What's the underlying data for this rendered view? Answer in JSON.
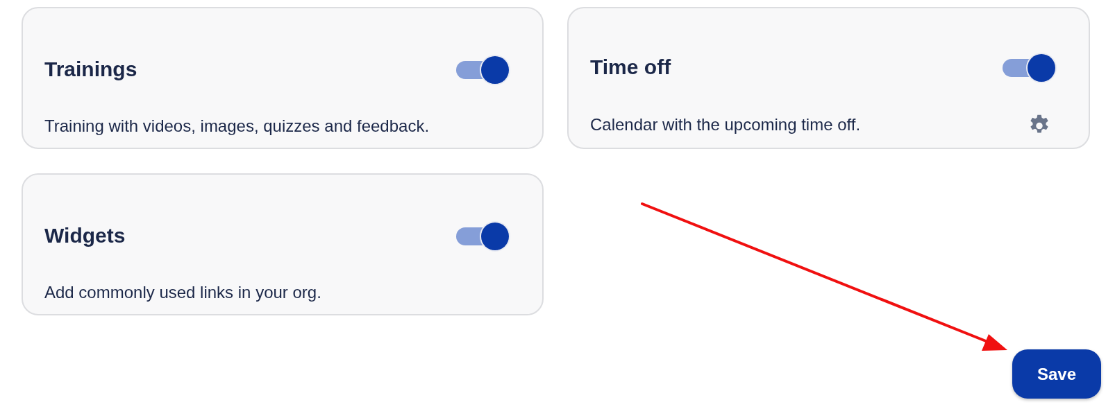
{
  "modules": [
    {
      "title": "Trainings",
      "description": "Training with videos, images, quizzes and feedback.",
      "on": true,
      "settings": false
    },
    {
      "title": "Time off",
      "description": "Calendar with the upcoming time off.",
      "on": true,
      "settings": true
    },
    {
      "title": "Widgets",
      "description": "Add commonly used links in your org.",
      "on": true,
      "settings": false
    }
  ],
  "annotation": {
    "kind": "arrow"
  },
  "save_button": {
    "label": "Save"
  }
}
